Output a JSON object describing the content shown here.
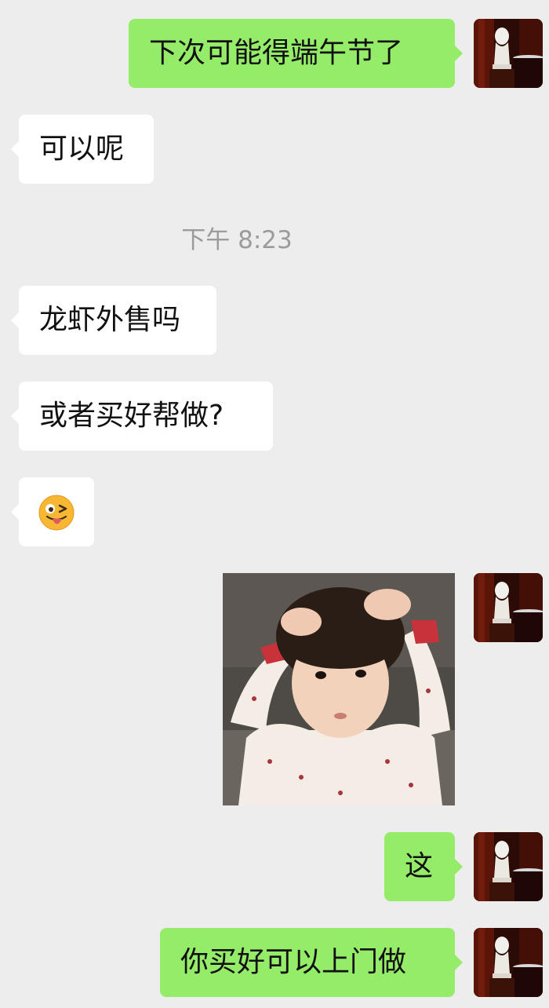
{
  "messages": {
    "m1": "下次可能得端午节了",
    "m2": "可以呢",
    "time": "下午 8:23",
    "m3": "龙虾外售吗",
    "m4": "或者买好帮做?",
    "m5_emoji": "winking-face-with-tongue",
    "m6_sticker": "toddler-holding-head-sticker",
    "m7": "这",
    "m8": "你买好可以上门做"
  },
  "colors": {
    "background": "#ededed",
    "incoming_bubble": "#ffffff",
    "outgoing_bubble": "#95ec69",
    "timestamp": "#9b9b9b"
  }
}
